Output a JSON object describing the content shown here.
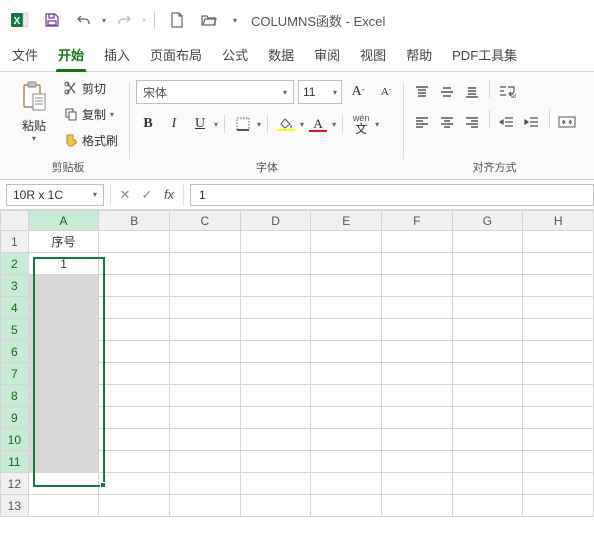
{
  "titlebar": {
    "doc_title": "COLUMNS函数 - Excel"
  },
  "tabs": {
    "items": [
      "文件",
      "开始",
      "插入",
      "页面布局",
      "公式",
      "数据",
      "审阅",
      "视图",
      "帮助",
      "PDF工具集"
    ],
    "active": 1
  },
  "ribbon": {
    "clipboard": {
      "paste": "粘贴",
      "cut": "剪切",
      "copy": "复制",
      "format_painter": "格式刷",
      "group_label": "剪贴板"
    },
    "font": {
      "font_name": "宋体",
      "font_size": "11",
      "wen_label": "wén",
      "group_label": "字体"
    },
    "align": {
      "group_label": "对齐方式"
    }
  },
  "formulabar": {
    "namebox": "10R x 1C",
    "formula": "1"
  },
  "grid": {
    "columns": [
      "A",
      "B",
      "C",
      "D",
      "E",
      "F",
      "G",
      "H"
    ],
    "row_count": 13,
    "cells": {
      "A1": "序号",
      "A2": "1"
    },
    "selected_cols": [
      "A"
    ],
    "selected_rows": [
      2,
      3,
      4,
      5,
      6,
      7,
      8,
      9,
      10,
      11
    ],
    "active_cell": "A2"
  }
}
